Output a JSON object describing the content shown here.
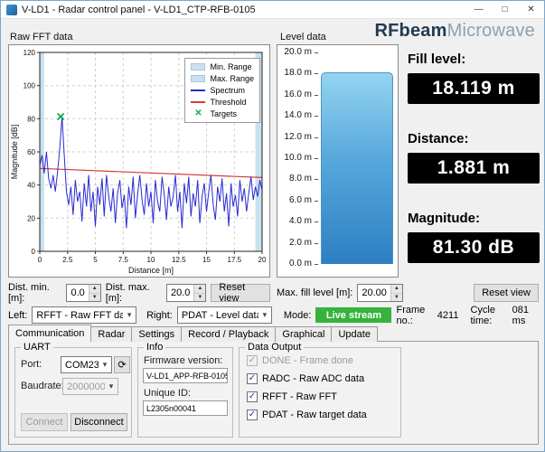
{
  "window": {
    "title": "V-LD1 - Radar control panel - V-LD1_CTP-RFB-0105",
    "minimize": "—",
    "maximize": "□",
    "close": "✕"
  },
  "logo": {
    "brand": "RFbeam",
    "name": "Microwave"
  },
  "sections": {
    "fft_label": "Raw FFT data",
    "level_label": "Level data"
  },
  "chart_data": {
    "type": "line",
    "xlabel": "Distance [m]",
    "ylabel": "Magnitude [dB]",
    "xlim": [
      0,
      20
    ],
    "ylim": [
      0,
      120
    ],
    "xticks": [
      0,
      2.5,
      5,
      7.5,
      10,
      12.5,
      15,
      17.5,
      20
    ],
    "yticks": [
      0,
      20,
      40,
      60,
      80,
      100,
      120
    ],
    "legend": [
      "Min. Range",
      "Max. Range",
      "Spectrum",
      "Threshold",
      "Targets"
    ],
    "min_range_band": [
      0,
      0.4
    ],
    "max_range_band": [
      19.4,
      20
    ],
    "spectrum": {
      "name": "Spectrum",
      "x_start": 0,
      "x_step": 0.2,
      "values": [
        52,
        58,
        47,
        60,
        44,
        38,
        46,
        36,
        48,
        62,
        81.3,
        58,
        36,
        28,
        39,
        22,
        43,
        30,
        36,
        18,
        41,
        27,
        46,
        24,
        36,
        15,
        39,
        28,
        44,
        21,
        46,
        33,
        24,
        38,
        17,
        35,
        43,
        26,
        34,
        14,
        39,
        28,
        45,
        20,
        34,
        46,
        31,
        22,
        41,
        27,
        36,
        17,
        43,
        30,
        24,
        45,
        34,
        19,
        39,
        27,
        33,
        46,
        24,
        36,
        14,
        41,
        29,
        45,
        21,
        35,
        27,
        43,
        17,
        33,
        41,
        24,
        36,
        46,
        28,
        19,
        39,
        30,
        44,
        24,
        35,
        15,
        41,
        27,
        34,
        21,
        43,
        30,
        38,
        24,
        35,
        45,
        31,
        39,
        33,
        43,
        37
      ]
    },
    "threshold": {
      "name": "Threshold",
      "x": [
        0,
        20
      ],
      "y": [
        50,
        44.5
      ]
    },
    "targets": [
      {
        "x": 1.881,
        "y": 81.3
      }
    ],
    "colors": {
      "band": "#c9e1ef",
      "spectrum": "#2a2ad0",
      "threshold": "#d23b3b",
      "target": "#0faf4f",
      "grid": "#cfcfcf"
    }
  },
  "gauge": {
    "max": 20,
    "fill_level": 18.119,
    "tick_labels": [
      "20.0 m",
      "18.0 m",
      "16.0 m",
      "14.0 m",
      "12.0 m",
      "10.0 m",
      "8.0 m",
      "6.0 m",
      "4.0 m",
      "2.0 m",
      "0.0 m"
    ]
  },
  "readouts": {
    "fill_label": "Fill level:",
    "fill_value": "18.119 m",
    "distance_label": "Distance:",
    "distance_value": "1.881 m",
    "magnitude_label": "Magnitude:",
    "magnitude_value": "81.30 dB"
  },
  "fft_controls": {
    "dist_min_label": "Dist. min. [m]:",
    "dist_min": "0.0",
    "dist_max_label": "Dist. max. [m]:",
    "dist_max": "20.0",
    "reset_label": "Reset view"
  },
  "level_controls": {
    "max_fill_label": "Max. fill level [m]:",
    "max_fill": "20.00",
    "reset_label": "Reset view"
  },
  "selectors": {
    "left_label": "Left:",
    "left_value": "RFFT - Raw FFT data",
    "right_label": "Right:",
    "right_value": "PDAT - Level data",
    "mode_label": "Mode:",
    "mode_value": "Live stream",
    "frame_label": "Frame no.:",
    "frame_value": "4211",
    "cycle_label": "Cycle time:",
    "cycle_value": "081 ms",
    "mode_color": "#35b33c"
  },
  "tabs": [
    "Communication",
    "Radar",
    "Settings",
    "Record / Playback",
    "Graphical",
    "Update"
  ],
  "uart": {
    "title": "UART",
    "port_label": "Port:",
    "port_value": "COM23",
    "baud_label": "Baudrate:",
    "baud_value": "2000000",
    "refresh_icon": "⟳",
    "connect": "Connect",
    "disconnect": "Disconnect"
  },
  "info": {
    "title": "Info",
    "fw_label": "Firmware version:",
    "fw_value": "V-LD1_APP-RFB-0105",
    "uid_label": "Unique ID:",
    "uid_value": "L2305n00041"
  },
  "data_output": {
    "title": "Data Output",
    "items": [
      {
        "label": "DONE - Frame done",
        "checked": true,
        "disabled": true
      },
      {
        "label": "RADC - Raw ADC data",
        "checked": true,
        "disabled": false
      },
      {
        "label": "RFFT - Raw FFT",
        "checked": true,
        "disabled": false
      },
      {
        "label": "PDAT - Raw target data",
        "checked": true,
        "disabled": false
      }
    ]
  }
}
